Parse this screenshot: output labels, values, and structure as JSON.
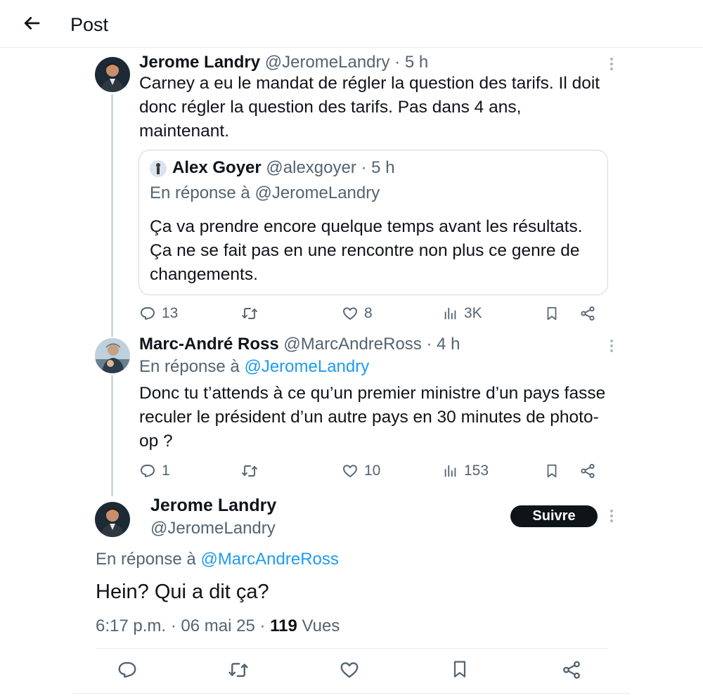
{
  "header": {
    "title": "Post"
  },
  "tweets": [
    {
      "name": "Jerome Landry",
      "handle": "@JeromeLandry",
      "time": "· 5 h",
      "text": "Carney a eu le mandat de régler la question des tarifs. Il doit donc régler la question des tarifs. Pas dans 4 ans, maintenant.",
      "quote": {
        "name": "Alex Goyer",
        "handle": "@alexgoyer",
        "time": "· 5 h",
        "reply_prefix": "En réponse à",
        "reply_mention": "@JeromeLandry",
        "text": "Ça va prendre encore quelque temps avant les résultats. Ça ne se fait pas en une rencontre non plus ce genre de changements."
      },
      "stats": {
        "replies": "13",
        "retweets": "",
        "likes": "8",
        "views": "3K"
      }
    },
    {
      "name": "Marc-André Ross",
      "handle": "@MarcAndreRoss",
      "time": "· 4 h",
      "reply_prefix": "En réponse à",
      "reply_mention": "@JeromeLandry",
      "text": "Donc tu t’attends à ce qu’un premier ministre d’un pays fasse reculer le président d’un autre pays en 30 minutes de photo-op ?",
      "stats": {
        "replies": "1",
        "retweets": "",
        "likes": "10",
        "views": "153"
      }
    }
  ],
  "main_tweet": {
    "name": "Jerome Landry",
    "handle": "@JeromeLandry",
    "follow_label": "Suivre",
    "reply_prefix": "En réponse à",
    "reply_mention": "@MarcAndreRoss",
    "text": "Hein? Qui a dit ça?",
    "time": "6:17 p.m.",
    "date": "06 mai 25",
    "views_count": "119",
    "views_label": "Vues"
  },
  "colors": {
    "text": "#0f1419",
    "secondary": "#536471",
    "link": "#1d9bf0",
    "border": "#cfd9de"
  },
  "icons": [
    "back-arrow-icon",
    "more-icon",
    "reply-icon",
    "retweet-icon",
    "like-icon",
    "views-icon",
    "bookmark-icon",
    "share-icon"
  ]
}
